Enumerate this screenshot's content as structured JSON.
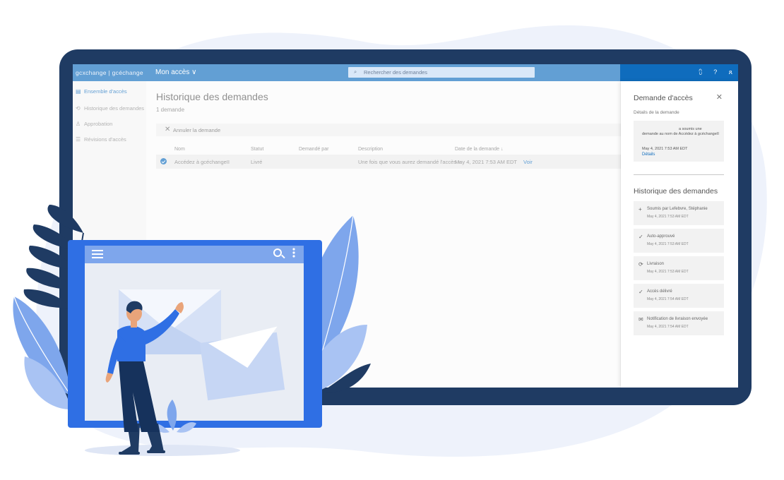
{
  "topbar": {
    "brand": "gcxchange | gcéchange",
    "nav_label": "Mon accès ∨",
    "search_placeholder": "Rechercher des demandes",
    "search_icon": "search-icon",
    "icons": [
      "org-chart-icon",
      "help-icon",
      "account-icon"
    ]
  },
  "sidebar": {
    "items": [
      {
        "label": "Ensemble d'accès",
        "icon": "package-icon",
        "active": true
      },
      {
        "label": "Historique des demandes",
        "icon": "history-icon",
        "active": false
      },
      {
        "label": "Approbation",
        "icon": "approval-icon",
        "active": false
      },
      {
        "label": "Révisions d'accès",
        "icon": "review-icon",
        "active": false
      }
    ]
  },
  "main": {
    "title": "Historique des demandes",
    "count": "1 demande",
    "cancel_label": "Annuler la demande",
    "columns": [
      "Nom",
      "Statut",
      "Demandé par",
      "Description",
      "Date de la demande ↓"
    ],
    "rows": [
      {
        "name": "Accédez à gcéchangeII",
        "status": "Livré",
        "requested_by": "",
        "description": "Une fois que vous aurez demandé l'accès »",
        "date": "May 4, 2021 7:53 AM EDT",
        "action": "Voir"
      }
    ]
  },
  "panel": {
    "title": "Demande d'accès",
    "subtitle": "Détails de la demande",
    "card": {
      "line1": "a soumis une",
      "line2": "demande au nom de Accédez à gcéchangeII",
      "line3": "May 4, 2021 7:53 AM EDT",
      "link": "Détails"
    },
    "history_title": "Historique des demandes",
    "history": [
      {
        "icon": "+",
        "icon_name": "plus-icon",
        "text": "Soumis par Lefebvre, Stéphanie",
        "date": "May 4, 2021 7:53 AM EDT"
      },
      {
        "icon": "✓",
        "icon_name": "check-icon",
        "text": "Auto-approuvé",
        "date": "May 4, 2021 7:53 AM EDT"
      },
      {
        "icon": "⟳",
        "icon_name": "sync-icon",
        "text": "Livraison",
        "date": "May 4, 2021 7:53 AM EDT"
      },
      {
        "icon": "✓",
        "icon_name": "check-icon",
        "text": "Accès délivré",
        "date": "May 4, 2021 7:54 AM EDT"
      },
      {
        "icon": "✉",
        "icon_name": "mail-icon",
        "text": "Notification de livraison envoyée",
        "date": "May 4, 2021 7:54 AM EDT"
      }
    ]
  },
  "colors": {
    "accent": "#0f6cbd",
    "device_frame": "#1f3b63",
    "illustration_blue": "#2f6fe4",
    "blob": "#eef2fb"
  }
}
